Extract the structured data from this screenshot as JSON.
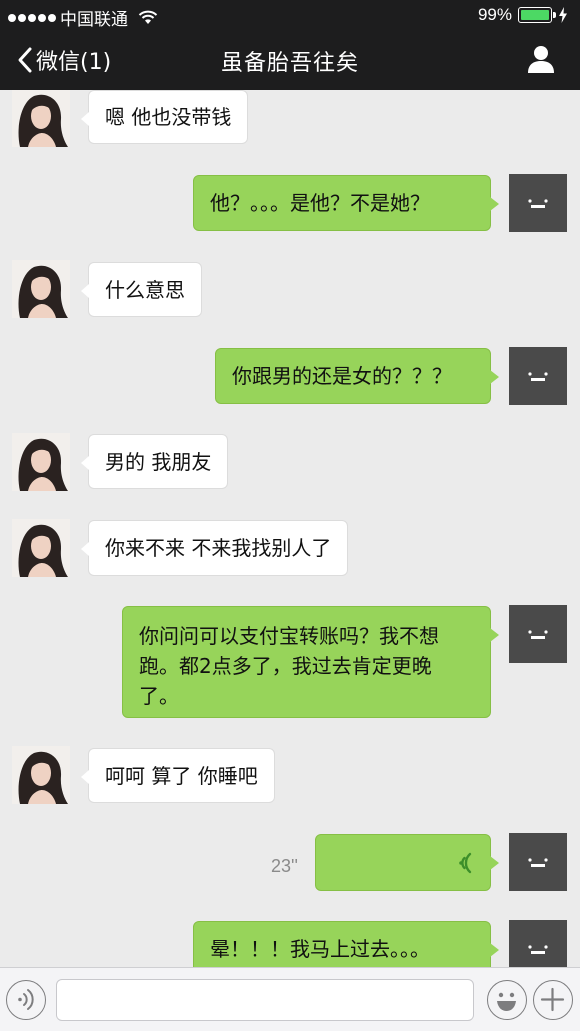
{
  "status_bar": {
    "carrier": "中国联通",
    "battery_percent": "99%",
    "battery_level": 0.99
  },
  "nav": {
    "back_label": "微信(1)",
    "title": "虽备胎吾往矣"
  },
  "messages": [
    {
      "side": "in",
      "text": "嗯 他也没带钱"
    },
    {
      "side": "out",
      "text": "他？。。。是他？不是她？"
    },
    {
      "side": "in",
      "text": "什么意思"
    },
    {
      "side": "out",
      "text": "你跟男的还是女的？？？"
    },
    {
      "side": "in",
      "text": "男的 我朋友"
    },
    {
      "side": "in",
      "text": "你来不来 不来我找别人了"
    },
    {
      "side": "out",
      "lines": [
        "你问问可以支付宝转账吗？我不想",
        "跑。都2点多了，我过去肯定更晚",
        "了。"
      ]
    },
    {
      "side": "in",
      "text": "呵呵 算了 你睡吧"
    },
    {
      "side": "out",
      "type": "voice",
      "duration": "23''"
    },
    {
      "side": "out",
      "text": "晕！！！我马上过去。。。"
    }
  ],
  "input_bar": {
    "text_value": ""
  },
  "colors": {
    "header_bg": "#1d1d1e",
    "chat_bg": "#ebebeb",
    "outgoing_bubble": "#97d45a",
    "incoming_bubble": "#ffffff",
    "battery": "#4cd964"
  },
  "icons": [
    "signal-dots-icon",
    "wifi-icon",
    "battery-icon",
    "charging-bolt-icon",
    "back-chevron-icon",
    "profile-icon",
    "voice-wave-icon",
    "voice-input-icon",
    "emoji-icon",
    "add-icon"
  ]
}
